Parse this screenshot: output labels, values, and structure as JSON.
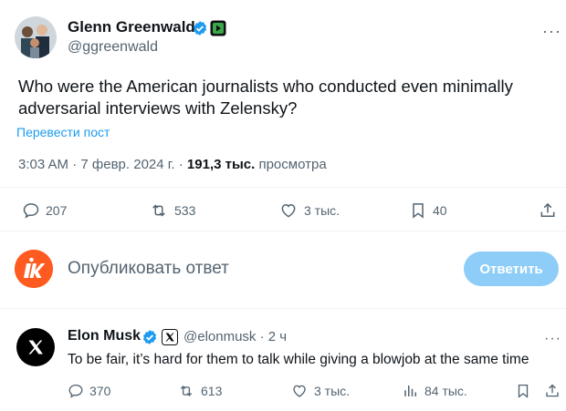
{
  "tweet": {
    "author_name": "Glenn Greenwald",
    "author_handle": "@ggreenwald",
    "more_label": "···",
    "text_line1": "Who were the American journalists who conducted even minimally",
    "text_line2": "adversarial interviews with Zelensky?",
    "translate_label": "Перевести пост",
    "time": "3:03 AM",
    "date": "7 февр. 2024 г.",
    "dot1": "·",
    "dot2": "·",
    "views_count": "191,3 тыс.",
    "views_label": "просмотра",
    "actions": {
      "replies": "207",
      "reposts": "533",
      "likes": "3 тыс.",
      "bookmarks": "40"
    }
  },
  "reply_box": {
    "placeholder": "Опубликовать ответ",
    "button_label": "Ответить"
  },
  "reply": {
    "author_name": "Elon Musk",
    "author_handle": "@elonmusk",
    "time_sep": "·",
    "time": "2 ч",
    "more_label": "···",
    "text": "To be fair, it’s hard for them to talk while giving a blowjob at the same time",
    "actions": {
      "replies": "370",
      "reposts": "613",
      "likes": "3 тыс.",
      "views": "84 тыс."
    }
  },
  "colors": {
    "accent": "#1d9bf0",
    "verified": "#1d9bf0",
    "reply_button": "#8ecdf8",
    "muted_text": "#536471",
    "affiliate_green": "#1a7f37"
  }
}
